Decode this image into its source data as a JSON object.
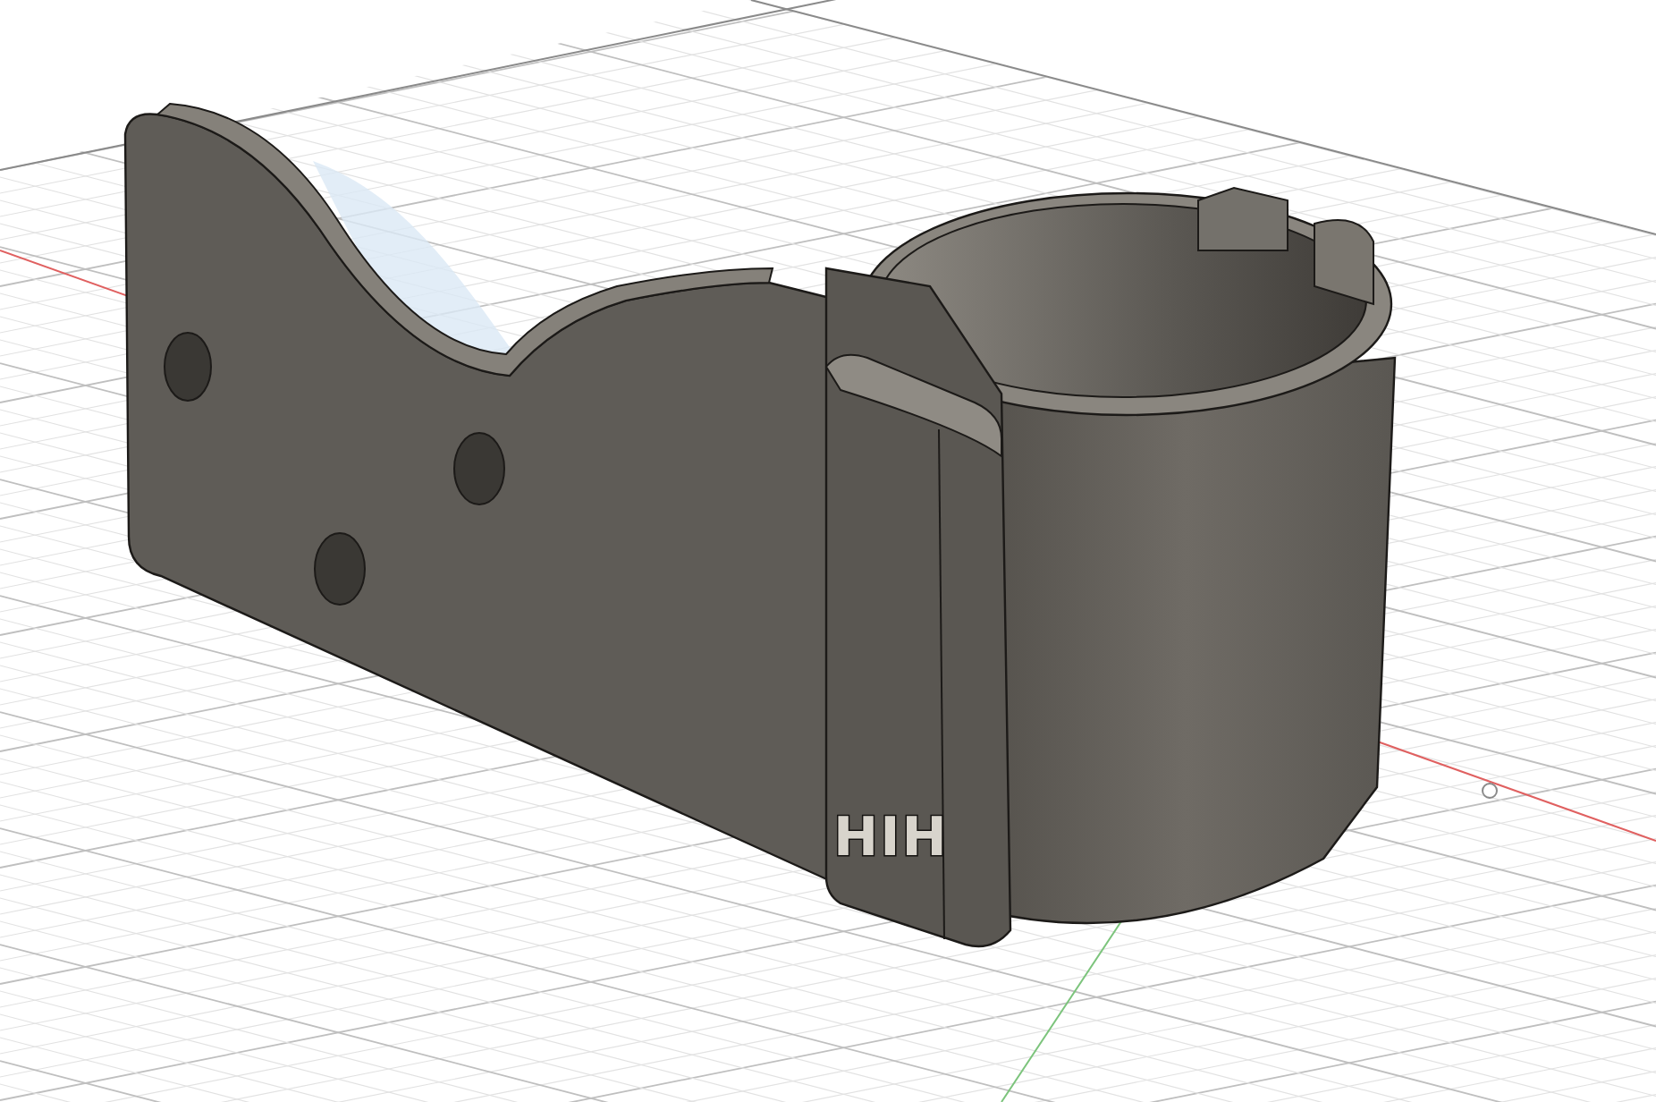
{
  "viewport": {
    "model": {
      "engraving": "HIH"
    }
  }
}
